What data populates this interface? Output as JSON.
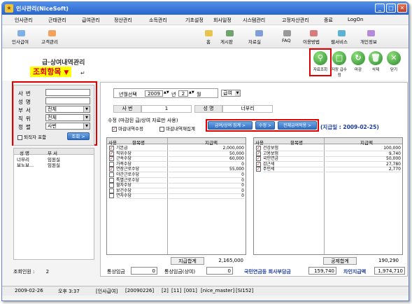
{
  "window": {
    "title": "인사관리(NiceSoft)",
    "controls": [
      "_",
      "□",
      "✕"
    ]
  },
  "menu": [
    "인사관리",
    "근태관리",
    "급여관리",
    "정산관리",
    "소득관리",
    "기초설정",
    "회사일정",
    "시스템관리",
    "고정자산관리",
    "종료",
    "LogOn"
  ],
  "toolbar": {
    "left": [
      "인사급여",
      "고객관리"
    ],
    "right": [
      "홈",
      "게시판",
      "자료실",
      "FAQ",
      "이용방법",
      "웹서비스",
      "개인정보"
    ]
  },
  "page": {
    "title": "급·상여내역관리",
    "annotation": "조회항목",
    "annotation_arrow": "▼",
    "return_mark": "↵"
  },
  "actions": {
    "query": "자료조회",
    "save": "저장\n급수정",
    "close_month": "마감",
    "delete": "삭제",
    "exit": "닫기"
  },
  "filter": {
    "labels": {
      "emp_no": "사번",
      "name": "성명",
      "dept": "부서",
      "position": "직위",
      "sort": "정렬"
    },
    "dept_value": "전체",
    "position_value": "전체",
    "sort_value": "사번",
    "retired_label": "퇴직자 포함",
    "query_button": "조회 >"
  },
  "employees": {
    "headers": [
      "성 명",
      "부 서"
    ],
    "rows": [
      {
        "name": "너부리",
        "dept": "임원실"
      },
      {
        "name": "보노보...",
        "dept": "임원실"
      }
    ],
    "count_label": "조회인원 :",
    "count": "2"
  },
  "controls": {
    "year_month_label": "년월선택",
    "year": "2009",
    "month": "2",
    "month_unit": "월",
    "type": "급여",
    "emp_no_label": "사 번",
    "emp_no_value": "1",
    "name_label": "성 명",
    "name_value": "너부리",
    "note": "수정 (마감된 급/상여 자료만 사용)",
    "chk_close_edit": "마감내역수정",
    "chk_close_sum": "마감내역재집계",
    "btn_recalc": "급여/상여 집계 >",
    "btn_edit": "수정 >",
    "btn_apply_all": "전체급여적용 >",
    "pay_date": "(지급일 : 2009-02-25)"
  },
  "earnings": {
    "headers": [
      "사용",
      "항목명",
      "지급액"
    ],
    "rows": [
      {
        "checked": true,
        "name": "기본급",
        "value": "2,000,000"
      },
      {
        "checked": true,
        "name": "직위수당",
        "value": "50,000"
      },
      {
        "checked": true,
        "name": "근속수당",
        "value": "60,000"
      },
      {
        "checked": false,
        "name": "가족수당",
        "value": "0"
      },
      {
        "checked": true,
        "name": "연장근로수당",
        "value": "55,000"
      },
      {
        "checked": false,
        "name": "야간근로수당",
        "value": "0"
      },
      {
        "checked": false,
        "name": "특별근로수당",
        "value": "0"
      },
      {
        "checked": false,
        "name": "월차수당",
        "value": "0"
      },
      {
        "checked": false,
        "name": "보건수당",
        "value": "0"
      },
      {
        "checked": false,
        "name": "연차수당",
        "value": "0"
      }
    ],
    "total_label": "지급합계",
    "total": "2,165,000"
  },
  "deductions": {
    "headers": [
      "사용",
      "항목명",
      "지급액"
    ],
    "rows": [
      {
        "checked": true,
        "name": "건강보험",
        "value": "100,000"
      },
      {
        "checked": true,
        "name": "고용보험",
        "value": "9,740"
      },
      {
        "checked": true,
        "name": "국민연금",
        "value": "50,000"
      },
      {
        "checked": true,
        "name": "갑근세",
        "value": "27,780"
      },
      {
        "checked": true,
        "name": "주민세",
        "value": "2,770"
      }
    ],
    "total_label": "공제합계",
    "total": "190,290"
  },
  "summary": {
    "normal_wage_label": "통상임금",
    "normal_wage": "0",
    "normal_wage_bonus_label": "통상임금(상여)",
    "normal_wage_bonus": "0",
    "pension_label": "국민연금등 회사부담금",
    "pension": "159,740",
    "net_label": "차인지급액",
    "net": "1,974,710"
  },
  "status": [
    "2009-02-26",
    "오후 3:37",
    "[인사급여]",
    "[20090226]",
    "[2]",
    "[11]",
    "[001]",
    "[nice_master]",
    "[SI152]"
  ],
  "colors": {
    "title_bar": "#2a64cc",
    "highlight": "#ffff00",
    "annotation_red": "#e00000",
    "button_blue": "#2f6fc2",
    "pay_date_blue": "#1a3a9a"
  }
}
